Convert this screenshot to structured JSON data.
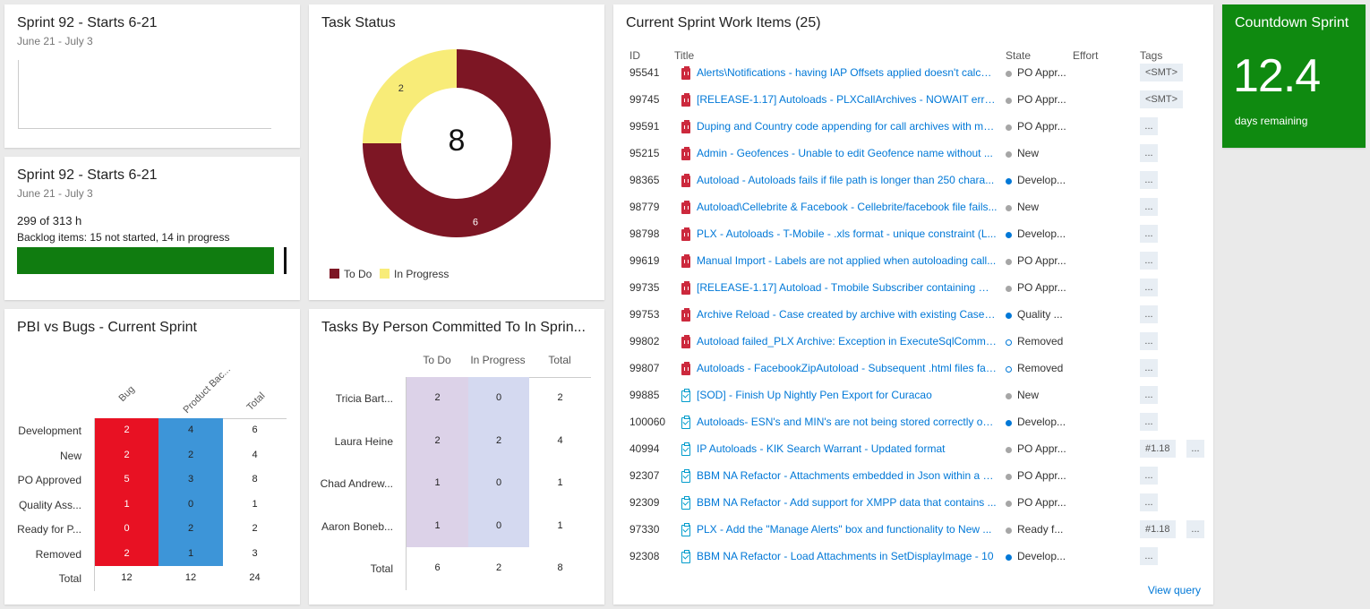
{
  "burndown": {
    "title": "Sprint 92 - Starts 6-21",
    "dates": "June 21 - July 3"
  },
  "capacity": {
    "title": "Sprint 92 - Starts 6-21",
    "dates": "June 21 - July 3",
    "hours_text": "299 of 313 h",
    "backlog_text": "Backlog items: 15 not started, 14 in progress",
    "progress_fraction": 0.955,
    "bar_color": "#107c10"
  },
  "task_status": {
    "title": "Task Status",
    "total_label": "8",
    "legend_todo": "To Do",
    "legend_inprogress": "In Progress",
    "label_todo": "6",
    "label_inprogress": "2"
  },
  "chart_data": {
    "type": "pie",
    "categories": [
      "To Do",
      "In Progress"
    ],
    "values": [
      6,
      2
    ],
    "colors": [
      "#7d1624",
      "#f8ec78"
    ],
    "donut": true,
    "title": "Task Status"
  },
  "pbi": {
    "title": "PBI vs Bugs - Current Sprint",
    "columns": [
      "Bug",
      "Product Bac...",
      "Total"
    ],
    "rows": [
      {
        "label": "Development",
        "bug": "2",
        "pbi": "4",
        "total": "6"
      },
      {
        "label": "New",
        "bug": "2",
        "pbi": "2",
        "total": "4"
      },
      {
        "label": "PO Approved",
        "bug": "5",
        "pbi": "3",
        "total": "8"
      },
      {
        "label": "Quality Ass...",
        "bug": "1",
        "pbi": "0",
        "total": "1"
      },
      {
        "label": "Ready for P...",
        "bug": "0",
        "pbi": "2",
        "total": "2"
      },
      {
        "label": "Removed",
        "bug": "2",
        "pbi": "1",
        "total": "3"
      }
    ],
    "total_row": {
      "label": "Total",
      "bug": "12",
      "pbi": "12",
      "total": "24"
    },
    "bug_color": "#e81123",
    "pbi_color": "#3d95d8"
  },
  "tasks_by_person": {
    "title": "Tasks By Person Committed To In Sprin...",
    "columns": [
      "To Do",
      "In Progress",
      "Total"
    ],
    "rows": [
      {
        "label": "Tricia Bart...",
        "todo": "2",
        "inprogress": "0",
        "total": "2"
      },
      {
        "label": "Laura Heine",
        "todo": "2",
        "inprogress": "2",
        "total": "4"
      },
      {
        "label": "Chad Andrew...",
        "todo": "1",
        "inprogress": "0",
        "total": "1"
      },
      {
        "label": "Aaron Boneb...",
        "todo": "1",
        "inprogress": "0",
        "total": "1"
      }
    ],
    "total_row": {
      "label": "Total",
      "todo": "6",
      "inprogress": "2",
      "total": "8"
    }
  },
  "work_items": {
    "title": "Current Sprint Work Items (25)",
    "headers": {
      "id": "ID",
      "title": "Title",
      "state": "State",
      "effort": "Effort",
      "tags": "Tags"
    },
    "view_query": "View query",
    "items": [
      {
        "id": "95541",
        "type": "bug",
        "title": "Alerts\\Notifications - having IAP Offsets applied doesn't calcul...",
        "state": "PO Appr...",
        "dot": "gray",
        "tags": [
          "<SMT>"
        ]
      },
      {
        "id": "99745",
        "type": "bug",
        "title": "[RELEASE-1.17] Autoloads - PLXCallArchives - NOWAIT error ...",
        "state": "PO Appr...",
        "dot": "gray",
        "tags": [
          "<SMT>"
        ]
      },
      {
        "id": "99591",
        "type": "bug",
        "title": "Duping and Country code appending for call archives with ma...",
        "state": "PO Appr...",
        "dot": "gray",
        "tags": [
          "..."
        ]
      },
      {
        "id": "95215",
        "type": "bug",
        "title": "Admin - Geofences - Unable to edit Geofence name without ...",
        "state": "New",
        "dot": "gray",
        "tags": [
          "..."
        ]
      },
      {
        "id": "98365",
        "type": "bug",
        "title": "Autoload - Autoloads fails if file path is longer than 250 chara...",
        "state": "Develop...",
        "dot": "blue",
        "tags": [
          "..."
        ]
      },
      {
        "id": "98779",
        "type": "bug",
        "title": "Autoload\\Cellebrite & Facebook - Cellebrite/facebook file fails...",
        "state": "New",
        "dot": "gray",
        "tags": [
          "..."
        ]
      },
      {
        "id": "98798",
        "type": "bug",
        "title": "PLX - Autoloads - T-Mobile - .xls format - unique constraint (L...",
        "state": "Develop...",
        "dot": "blue",
        "tags": [
          "..."
        ]
      },
      {
        "id": "99619",
        "type": "bug",
        "title": "Manual Import - Labels are not applied when autoloading call...",
        "state": "PO Appr...",
        "dot": "gray",
        "tags": [
          "..."
        ]
      },
      {
        "id": "99735",
        "type": "bug",
        "title": "[RELEASE-1.17] Autoload - Tmobile Subscriber containing mul...",
        "state": "PO Appr...",
        "dot": "gray",
        "tags": [
          "..."
        ]
      },
      {
        "id": "99753",
        "type": "bug",
        "title": "Archive Reload - Case created by archive with existing Case N...",
        "state": "Quality ...",
        "dot": "blue",
        "tags": [
          "..."
        ]
      },
      {
        "id": "99802",
        "type": "bug",
        "title": "Autoload failed_PLX Archive: Exception in ExecuteSqlComman...",
        "state": "Removed",
        "dot": "hollow",
        "tags": [
          "..."
        ]
      },
      {
        "id": "99807",
        "type": "bug",
        "title": "Autoloads - FacebookZipAutoload - Subsequent .html files fail...",
        "state": "Removed",
        "dot": "hollow",
        "tags": [
          "..."
        ]
      },
      {
        "id": "99885",
        "type": "task",
        "title": "[SOD] - Finish Up Nightly Pen Export for Curacao",
        "state": "New",
        "dot": "gray",
        "tags": [
          "..."
        ]
      },
      {
        "id": "100060",
        "type": "task",
        "title": "Autoloads- ESN's and MIN's are not being stored correctly on ...",
        "state": "Develop...",
        "dot": "blue",
        "tags": [
          "..."
        ]
      },
      {
        "id": "40994",
        "type": "task",
        "title": "IP Autoloads - KIK Search Warrant - Updated format",
        "state": "PO Appr...",
        "dot": "gray",
        "tags": [
          "#1.18",
          "..."
        ]
      },
      {
        "id": "92307",
        "type": "task",
        "title": "BBM NA Refactor - Attachments embedded in Json within a <...",
        "state": "PO Appr...",
        "dot": "gray",
        "tags": [
          "..."
        ]
      },
      {
        "id": "92309",
        "type": "task",
        "title": "BBM NA Refactor - Add support for XMPP data that contains ...",
        "state": "PO Appr...",
        "dot": "gray",
        "tags": [
          "..."
        ]
      },
      {
        "id": "97330",
        "type": "task",
        "title": "PLX - Add the \"Manage Alerts\" box and functionality to New ...",
        "state": "Ready f...",
        "dot": "gray",
        "tags": [
          "#1.18",
          "..."
        ]
      },
      {
        "id": "92308",
        "type": "task",
        "title": "BBM NA Refactor - Load Attachments in SetDisplayImage - 10",
        "state": "Develop...",
        "dot": "blue",
        "tags": [
          "..."
        ]
      }
    ]
  },
  "countdown": {
    "title": "Countdown Sprint",
    "value": "12.4",
    "caption": "days remaining",
    "color": "#0f8a10"
  },
  "colors": {
    "dot_gray": "#a6a6a6",
    "dot_blue": "#0078d7",
    "link": "#0078d7",
    "purple_cell": "#dcd2e8",
    "lavender_cell": "#d4d9f0"
  }
}
